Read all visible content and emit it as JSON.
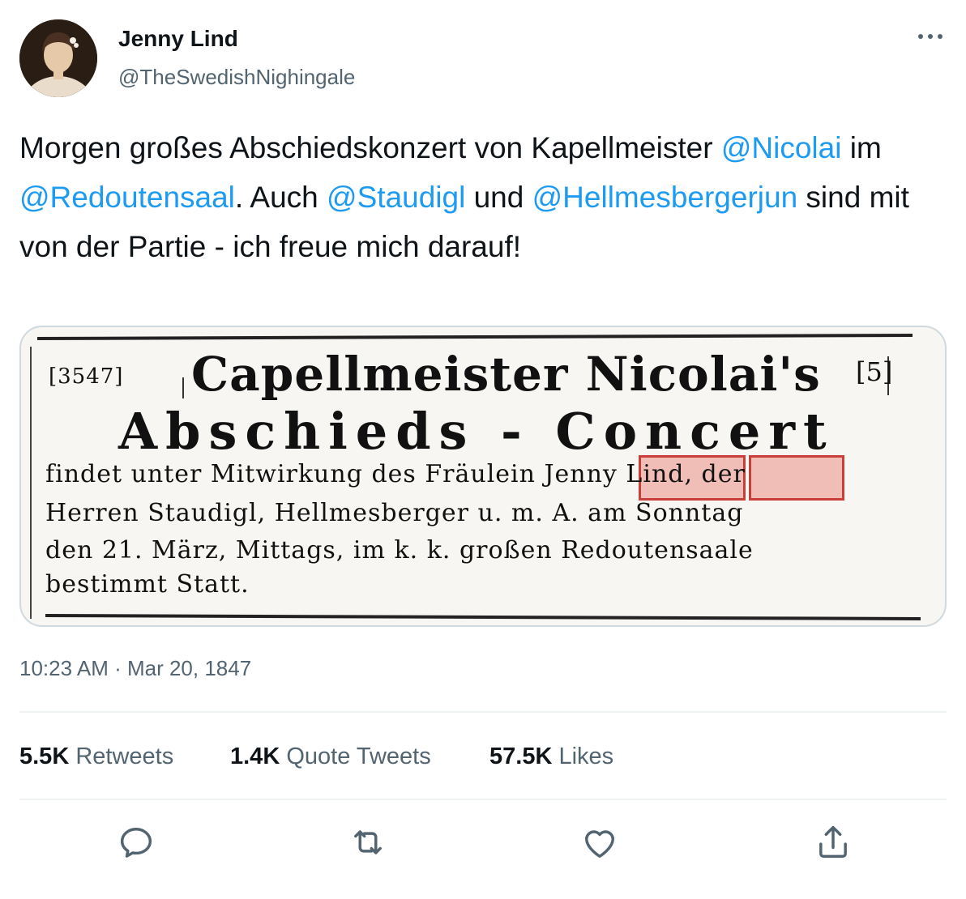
{
  "author": {
    "name": "Jenny Lind",
    "handle": "@TheSwedishNighingale"
  },
  "tweet": {
    "segments": [
      {
        "type": "text",
        "value": "Morgen großes Abschiedskonzert von Kapellmeister "
      },
      {
        "type": "mention",
        "value": "@Nicolai"
      },
      {
        "type": "text",
        "value": " im "
      },
      {
        "type": "mention",
        "value": "@Redoutensaal"
      },
      {
        "type": "text",
        "value": ". Auch "
      },
      {
        "type": "mention",
        "value": "@Staudigl"
      },
      {
        "type": "text",
        "value": " und "
      },
      {
        "type": "mention",
        "value": "@Hellmesbergerjun"
      },
      {
        "type": "text",
        "value": " sind mit von der Partie - ich freue mich darauf!"
      }
    ]
  },
  "media": {
    "number": "[3547]",
    "corner": "[5]",
    "title_line1": "Capellmeister Nicolai's",
    "title_line2": "Abschieds - Concert",
    "line1_a": "findet unter Mitwirkung des Fräulein ",
    "highlight1": "Jenny",
    "highlight2": "Lind,",
    "line1_b": " der",
    "line2": "Herren Staudigl, Hellmesberger u. m. A. am Sonntag",
    "line3": "den 21. März, Mittags, im k. k. großen Redoutensaale",
    "line4": "bestimmt Statt."
  },
  "timestamp": "10:23 AM · Mar 20, 1847",
  "stats": {
    "retweets": {
      "count": "5.5K",
      "label": "Retweets"
    },
    "quotes": {
      "count": "1.4K",
      "label": "Quote Tweets"
    },
    "likes": {
      "count": "57.5K",
      "label": "Likes"
    }
  },
  "icons": {
    "more": "more-dots-icon",
    "reply": "reply-icon",
    "retweet": "retweet-icon",
    "like": "heart-icon",
    "share": "share-icon"
  },
  "colors": {
    "mention": "#1d9bf0",
    "secondary_text": "#536471",
    "highlight_border": "#c9403a"
  }
}
